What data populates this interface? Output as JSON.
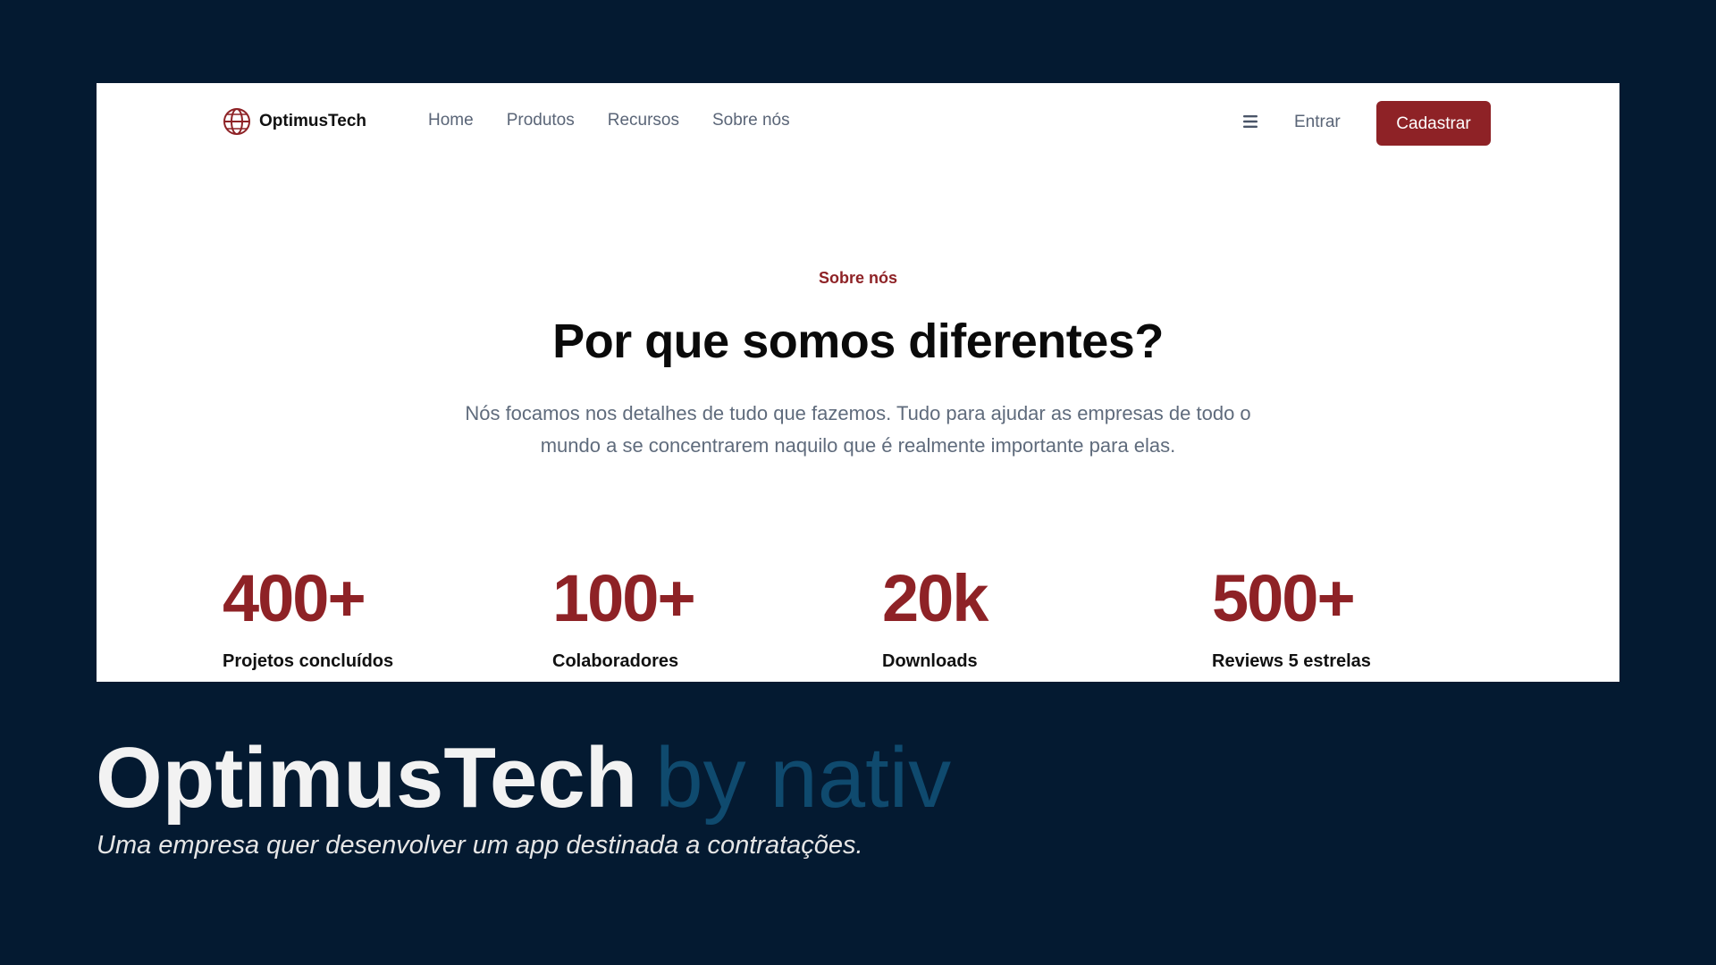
{
  "header": {
    "brand": "OptimusTech",
    "nav": [
      "Home",
      "Produtos",
      "Recursos",
      "Sobre nós"
    ],
    "login_label": "Entrar",
    "signup_label": "Cadastrar"
  },
  "hero": {
    "eyebrow": "Sobre nós",
    "title": "Por que somos diferentes?",
    "description": "Nós focamos nos detalhes de tudo que fazemos. Tudo para ajudar as empresas de todo o mundo a se concentrarem naquilo que é realmente importante para elas."
  },
  "stats": [
    {
      "value": "400+",
      "label": "Projetos concluídos"
    },
    {
      "value": "100+",
      "label": "Colaboradores"
    },
    {
      "value": "20k",
      "label": "Downloads"
    },
    {
      "value": "500+",
      "label": "Reviews 5 estrelas"
    }
  ],
  "caption": {
    "title": "OptimusTech",
    "title_suffix": "by nativ",
    "subtitle": "Uma empresa quer desenvolver um app destinada a contratações."
  },
  "colors": {
    "background": "#041a31",
    "accent": "#8e2226",
    "suffix": "#0f4a6e"
  },
  "icons": {
    "logo": "globe-icon",
    "menu": "hamburger-menu-icon"
  }
}
